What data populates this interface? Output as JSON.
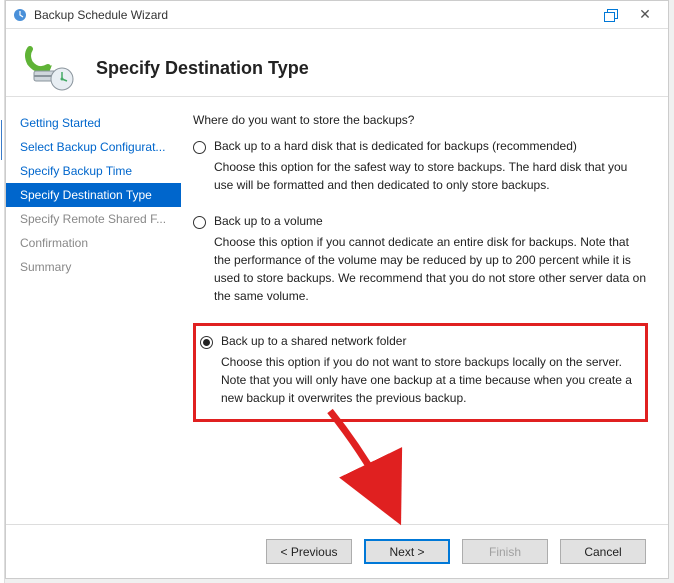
{
  "titlebar": {
    "title": "Backup Schedule Wizard"
  },
  "header": {
    "title": "Specify Destination Type"
  },
  "sidebar": {
    "items": [
      {
        "label": "Getting Started",
        "state": "done"
      },
      {
        "label": "Select Backup Configurat...",
        "state": "done"
      },
      {
        "label": "Specify Backup Time",
        "state": "done"
      },
      {
        "label": "Specify Destination Type",
        "state": "active"
      },
      {
        "label": "Specify Remote Shared F...",
        "state": "pending"
      },
      {
        "label": "Confirmation",
        "state": "pending"
      },
      {
        "label": "Summary",
        "state": "pending"
      }
    ]
  },
  "content": {
    "question": "Where do you want to store the backups?",
    "options": [
      {
        "label": "Back up to a hard disk that is dedicated for backups (recommended)",
        "desc": "Choose this option for the safest way to store backups. The hard disk that you use will be formatted and then dedicated to only store backups.",
        "checked": false
      },
      {
        "label": "Back up to a volume",
        "desc": "Choose this option if you cannot dedicate an entire disk for backups. Note that the performance of the volume may be reduced by up to 200 percent while it is used to store backups. We recommend that you do not store other server data on the same volume.",
        "checked": false
      },
      {
        "label": "Back up to a shared network folder",
        "desc": "Choose this option if you do not want to store backups locally on the server. Note that you will only have one backup at a time because when you create a new backup it overwrites the previous backup.",
        "checked": true,
        "highlighted": true
      }
    ]
  },
  "footer": {
    "previous": "< Previous",
    "next": "Next >",
    "finish": "Finish",
    "cancel": "Cancel"
  }
}
